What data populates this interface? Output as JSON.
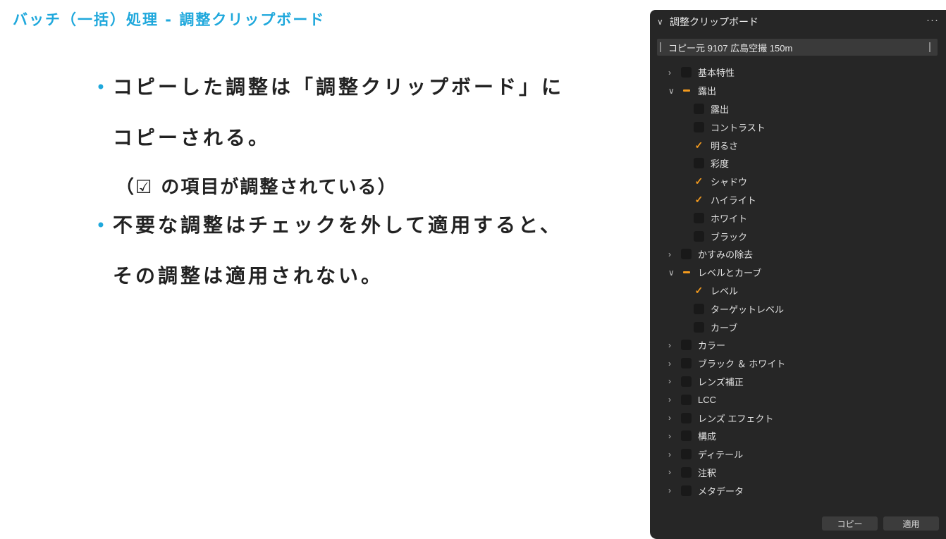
{
  "slide": {
    "title": "バッチ（一括）処理 - 調整クリップボード",
    "bullets": [
      {
        "line1": "コピーした調整は「調整クリップボード」に",
        "line2": "コピーされる。"
      },
      {
        "line1": "不要な調整はチェックを外して適用すると、",
        "line2": "その調整は適用されない。"
      }
    ],
    "note": "（☑ の項目が調整されている）",
    "accent_color": "#1fa8dc"
  },
  "panel": {
    "title": "調整クリップボード",
    "more_icon": "more-icon",
    "source_label": "コピー元 9107 広島空撮 150m",
    "check_color": "#f39a1e",
    "items": [
      {
        "label": "基本特性",
        "level": 0,
        "expand": "collapsed",
        "state": "unchecked"
      },
      {
        "label": "露出",
        "level": 0,
        "expand": "expanded",
        "state": "mixed"
      },
      {
        "label": "露出",
        "level": 1,
        "state": "unchecked"
      },
      {
        "label": "コントラスト",
        "level": 1,
        "state": "unchecked"
      },
      {
        "label": "明るさ",
        "level": 1,
        "state": "checked"
      },
      {
        "label": "彩度",
        "level": 1,
        "state": "unchecked"
      },
      {
        "label": "シャドウ",
        "level": 1,
        "state": "checked"
      },
      {
        "label": "ハイライト",
        "level": 1,
        "state": "checked"
      },
      {
        "label": "ホワイト",
        "level": 1,
        "state": "unchecked"
      },
      {
        "label": "ブラック",
        "level": 1,
        "state": "unchecked"
      },
      {
        "label": "かすみの除去",
        "level": 0,
        "expand": "collapsed",
        "state": "unchecked"
      },
      {
        "label": "レベルとカーブ",
        "level": 0,
        "expand": "expanded",
        "state": "mixed"
      },
      {
        "label": "レベル",
        "level": 1,
        "state": "checked"
      },
      {
        "label": "ターゲットレベル",
        "level": 1,
        "state": "unchecked"
      },
      {
        "label": "カーブ",
        "level": 1,
        "state": "unchecked"
      },
      {
        "label": "カラー",
        "level": 0,
        "expand": "collapsed",
        "state": "unchecked"
      },
      {
        "label": "ブラック ＆ ホワイト",
        "level": 0,
        "expand": "collapsed",
        "state": "unchecked"
      },
      {
        "label": "レンズ補正",
        "level": 0,
        "expand": "collapsed",
        "state": "unchecked"
      },
      {
        "label": "LCC",
        "level": 0,
        "expand": "collapsed",
        "state": "unchecked"
      },
      {
        "label": "レンズ エフェクト",
        "level": 0,
        "expand": "collapsed",
        "state": "unchecked"
      },
      {
        "label": "構成",
        "level": 0,
        "expand": "collapsed",
        "state": "unchecked"
      },
      {
        "label": "ディテール",
        "level": 0,
        "expand": "collapsed",
        "state": "unchecked"
      },
      {
        "label": "注釈",
        "level": 0,
        "expand": "collapsed",
        "state": "unchecked"
      },
      {
        "label": "メタデータ",
        "level": 0,
        "expand": "collapsed",
        "state": "unchecked"
      }
    ],
    "copy_button": "コピー",
    "apply_button": "適用"
  }
}
